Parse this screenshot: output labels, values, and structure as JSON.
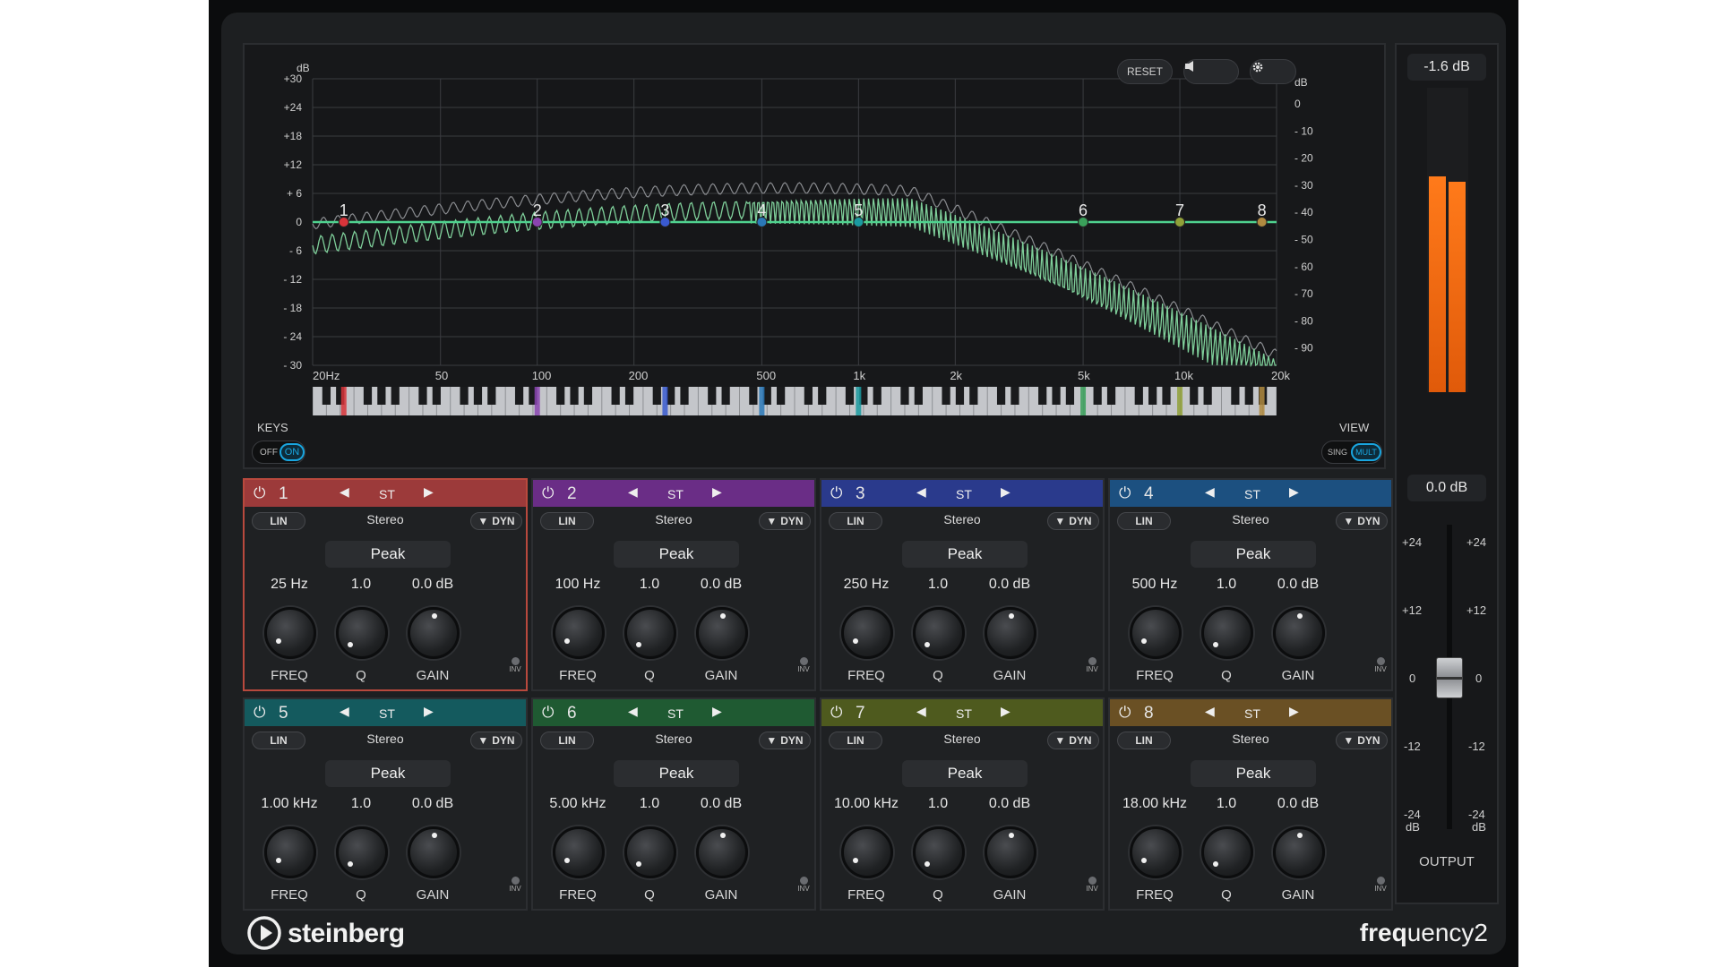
{
  "header": {
    "reset_label": "RESET",
    "speaker_icon": "speaker-icon",
    "settings_icon": "gear-icon"
  },
  "graph": {
    "left_unit": "dB",
    "right_unit": "dB",
    "left_scale": [
      "+30",
      "+24",
      "+18",
      "+12",
      "+ 6",
      "0",
      "- 6",
      "- 12",
      "- 18",
      "- 24",
      "- 30"
    ],
    "right_scale": [
      "0",
      "- 10",
      "- 20",
      "- 30",
      "- 40",
      "- 50",
      "- 60",
      "- 70",
      "- 80",
      "- 90"
    ],
    "freq_labels": [
      "20Hz",
      "50",
      "100",
      "200",
      "500",
      "1k",
      "2k",
      "5k",
      "10k",
      "20k"
    ],
    "node_labels": [
      "1",
      "2",
      "3",
      "4",
      "5",
      "6",
      "7",
      "8"
    ],
    "keys_label": "KEYS",
    "keys_off": "OFF",
    "keys_on": "ON",
    "view_label": "VIEW",
    "view_sing": "SING",
    "view_mult": "MULT"
  },
  "meter": {
    "peak_readout": "-1.6 dB",
    "gain_readout": "0.0 dB",
    "level_left": 0.71,
    "level_right": 0.69,
    "fader_scale": [
      "+24",
      "+12",
      "0",
      "-12",
      "-24"
    ],
    "fader_unit": "dB",
    "output_label": "OUTPUT"
  },
  "bands": [
    {
      "num": "1",
      "color": "#9c3a3a",
      "st": "ST",
      "lin": "LIN",
      "stereo": "Stereo",
      "dyn": "DYN",
      "type": "Peak",
      "freq": "25 Hz",
      "q": "1.0",
      "gain": "0.0 dB",
      "freq_label": "FREQ",
      "q_label": "Q",
      "gain_label": "GAIN",
      "inv": "INV"
    },
    {
      "num": "2",
      "color": "#6a2d86",
      "st": "ST",
      "lin": "LIN",
      "stereo": "Stereo",
      "dyn": "DYN",
      "type": "Peak",
      "freq": "100 Hz",
      "q": "1.0",
      "gain": "0.0 dB",
      "freq_label": "FREQ",
      "q_label": "Q",
      "gain_label": "GAIN",
      "inv": "INV"
    },
    {
      "num": "3",
      "color": "#2a3a8c",
      "st": "ST",
      "lin": "LIN",
      "stereo": "Stereo",
      "dyn": "DYN",
      "type": "Peak",
      "freq": "250 Hz",
      "q": "1.0",
      "gain": "0.0 dB",
      "freq_label": "FREQ",
      "q_label": "Q",
      "gain_label": "GAIN",
      "inv": "INV"
    },
    {
      "num": "4",
      "color": "#1c5080",
      "st": "ST",
      "lin": "LIN",
      "stereo": "Stereo",
      "dyn": "DYN",
      "type": "Peak",
      "freq": "500 Hz",
      "q": "1.0",
      "gain": "0.0 dB",
      "freq_label": "FREQ",
      "q_label": "Q",
      "gain_label": "GAIN",
      "inv": "INV"
    },
    {
      "num": "5",
      "color": "#145a5e",
      "st": "ST",
      "lin": "LIN",
      "stereo": "Stereo",
      "dyn": "DYN",
      "type": "Peak",
      "freq": "1.00 kHz",
      "q": "1.0",
      "gain": "0.0 dB",
      "freq_label": "FREQ",
      "q_label": "Q",
      "gain_label": "GAIN",
      "inv": "INV"
    },
    {
      "num": "6",
      "color": "#1f5a32",
      "st": "ST",
      "lin": "LIN",
      "stereo": "Stereo",
      "dyn": "DYN",
      "type": "Peak",
      "freq": "5.00 kHz",
      "q": "1.0",
      "gain": "0.0 dB",
      "freq_label": "FREQ",
      "q_label": "Q",
      "gain_label": "GAIN",
      "inv": "INV"
    },
    {
      "num": "7",
      "color": "#4e5a1e",
      "st": "ST",
      "lin": "LIN",
      "stereo": "Stereo",
      "dyn": "DYN",
      "type": "Peak",
      "freq": "10.00 kHz",
      "q": "1.0",
      "gain": "0.0 dB",
      "freq_label": "FREQ",
      "q_label": "Q",
      "gain_label": "GAIN",
      "inv": "INV"
    },
    {
      "num": "8",
      "color": "#6a5024",
      "st": "ST",
      "lin": "LIN",
      "stereo": "Stereo",
      "dyn": "DYN",
      "type": "Peak",
      "freq": "18.00 kHz",
      "q": "1.0",
      "gain": "0.0 dB",
      "freq_label": "FREQ",
      "q_label": "Q",
      "gain_label": "GAIN",
      "inv": "INV"
    }
  ],
  "node_colors": [
    "#d8343a",
    "#8a44b0",
    "#3a5ad0",
    "#2a78b8",
    "#1a9aa0",
    "#3aa05a",
    "#90a038",
    "#b08a40"
  ],
  "footer": {
    "brand": "steinberg",
    "product_bold": "freq",
    "product_rest": "uency2"
  }
}
